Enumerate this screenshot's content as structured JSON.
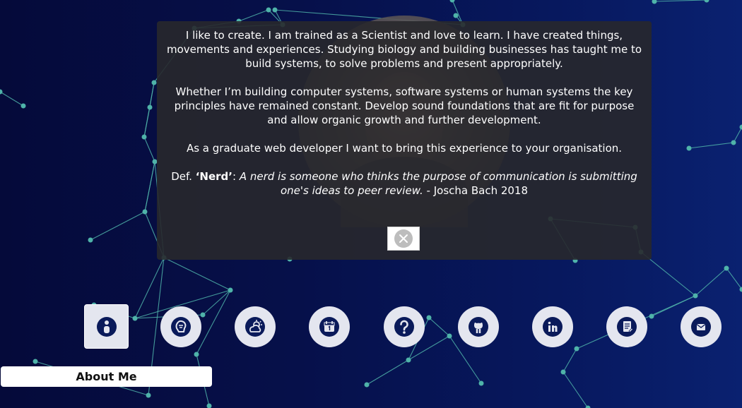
{
  "colors": {
    "network_line": "#4fb3a9",
    "nav_icon_bg": "#e4e6ef",
    "nav_icon_fg": "#0a1a5a",
    "modal_bg": "rgba(40,40,44,0.9)"
  },
  "modal": {
    "paragraph1": "I like to create. I am trained as a Scientist and love to learn. I have created things, movements and experiences. Studying biology and building businesses has taught me to build systems, to solve problems and present appropriately.",
    "paragraph2": "Whether I’m building computer systems, software systems or human systems the key principles have remained constant. Develop sound foundations that are fit for purpose and allow organic growth and further development.",
    "paragraph3": "As a graduate web developer I want to bring this experience to your organisation.",
    "quote_prefix": "Def. ",
    "quote_term": "‘Nerd’",
    "quote_colon": ": ",
    "quote_text": "A nerd is someone who thinks the purpose of communication is submitting one's ideas to peer review.",
    "quote_attribution": " - Joscha Bach 2018"
  },
  "nav": {
    "items": [
      {
        "icon": "person-icon"
      },
      {
        "icon": "brain-icon"
      },
      {
        "icon": "weather-icon"
      },
      {
        "icon": "calendar-icon"
      },
      {
        "icon": "question-icon"
      },
      {
        "icon": "github-icon"
      },
      {
        "icon": "linkedin-icon"
      },
      {
        "icon": "document-icon"
      },
      {
        "icon": "mail-icon"
      }
    ]
  },
  "tooltip": {
    "label": "About Me"
  }
}
